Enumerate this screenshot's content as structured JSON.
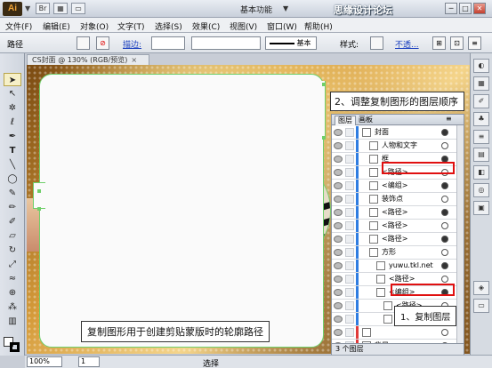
{
  "app": {
    "logo": "Ai",
    "workspace": "基本功能",
    "watermark": "思缘设计论坛 www.missyuan.com",
    "window_buttons": [
      "─",
      "□",
      "✕"
    ]
  },
  "menu": [
    "文件(F)",
    "编辑(E)",
    "对象(O)",
    "文字(T)",
    "选择(S)",
    "效果(C)",
    "视图(V)",
    "窗口(W)",
    "帮助(H)"
  ],
  "control": {
    "selection_type": "路径",
    "stroke_link": "描边:",
    "brush_label": "基本",
    "style_label": "样式:",
    "opacity_link": "不透...",
    "mode_label": "框"
  },
  "document": {
    "tab_title": "CS封面 @ 130% (RGB/预览)",
    "close": "×"
  },
  "callouts": {
    "top": "2、调整复制图形的图层顺序",
    "bottom_left": "复制图形用于创建剪贴蒙版时的轮廓路径",
    "bottom_right": "1、复制图层"
  },
  "layers_panel": {
    "tabs": [
      "图层",
      "画板"
    ],
    "rows": [
      {
        "indent": 0,
        "name": "封面",
        "bar": "#2f7de1"
      },
      {
        "indent": 1,
        "name": "人物和文字",
        "bar": "#2f7de1"
      },
      {
        "indent": 1,
        "name": "框",
        "bar": "#2f7de1"
      },
      {
        "indent": 1,
        "name": "<路径>",
        "bar": "#2f7de1"
      },
      {
        "indent": 1,
        "name": "<编组>",
        "bar": "#2f7de1"
      },
      {
        "indent": 1,
        "name": "装饰点",
        "bar": "#2f7de1"
      },
      {
        "indent": 1,
        "name": "<路径>",
        "bar": "#2f7de1"
      },
      {
        "indent": 1,
        "name": "<路径>",
        "bar": "#2f7de1"
      },
      {
        "indent": 1,
        "name": "<路径>",
        "bar": "#2f7de1"
      },
      {
        "indent": 1,
        "name": "方形",
        "bar": "#2f7de1"
      },
      {
        "indent": 2,
        "name": "yuwu.tkl.net",
        "bar": "#2f7de1"
      },
      {
        "indent": 2,
        "name": "<路径>",
        "bar": "#2f7de1"
      },
      {
        "indent": 2,
        "name": "<编组>",
        "bar": "#2f7de1"
      },
      {
        "indent": 3,
        "name": "<路径>",
        "bar": "#2f7de1"
      },
      {
        "indent": 3,
        "name": "",
        "bar": "#2f7de1"
      },
      {
        "indent": 0,
        "name": "",
        "bar": "#e03a3a"
      },
      {
        "indent": 0,
        "name": "背景",
        "bar": "#e03a3a"
      }
    ],
    "footer": "3 个图层"
  },
  "status": {
    "zoom": "100%",
    "page": "1",
    "tool": "选择"
  },
  "colors": {
    "highlight": "#e01010",
    "path_green": "#6fcf6a"
  }
}
